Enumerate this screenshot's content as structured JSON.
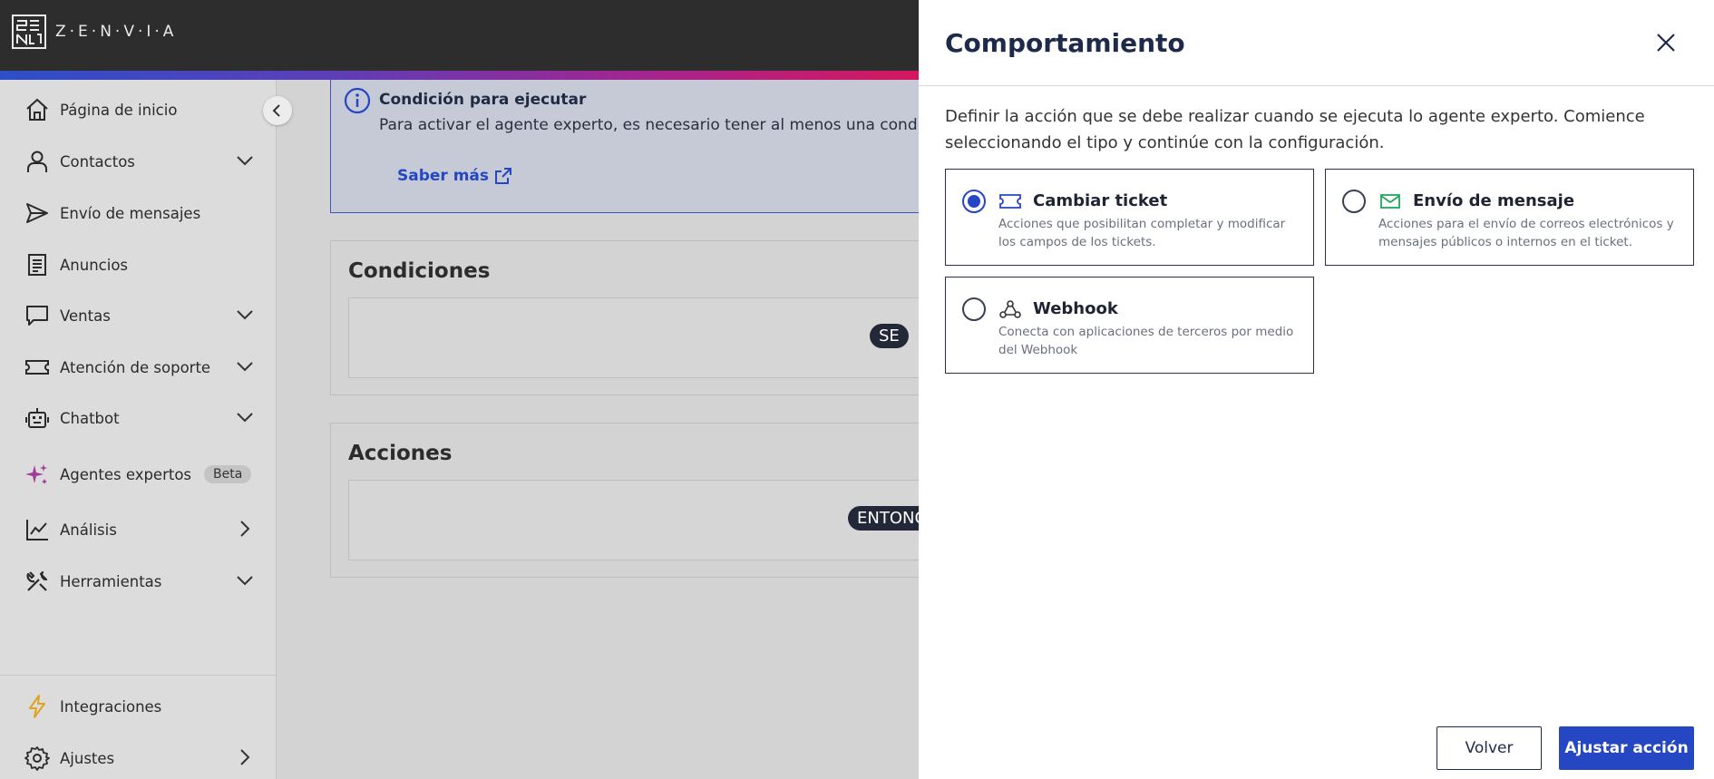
{
  "brand": {
    "name": "Z·E·N·V·I·A"
  },
  "sidebar": {
    "items": [
      {
        "label": "Página de inicio",
        "icon": "home-icon",
        "chevron": "none"
      },
      {
        "label": "Contactos",
        "icon": "user-icon",
        "chevron": "down"
      },
      {
        "label": "Envío de mensajes",
        "icon": "send-icon",
        "chevron": "none"
      },
      {
        "label": "Anuncios",
        "icon": "document-icon",
        "chevron": "none"
      },
      {
        "label": "Ventas",
        "icon": "chat-bubble-icon",
        "chevron": "down"
      },
      {
        "label": "Atención de soporte",
        "icon": "ticket-icon",
        "chevron": "down"
      },
      {
        "label": "Chatbot",
        "icon": "robot-icon",
        "chevron": "down"
      },
      {
        "label": "Agentes expertos",
        "icon": "sparkles-icon",
        "chevron": "none",
        "badge": "Beta"
      },
      {
        "label": "Análisis",
        "icon": "chart-line-icon",
        "chevron": "right"
      },
      {
        "label": "Herramientas",
        "icon": "tools-icon",
        "chevron": "down"
      }
    ],
    "bottom_items": [
      {
        "label": "Integraciones",
        "icon": "lightning-icon"
      },
      {
        "label": "Ajustes",
        "icon": "gear-icon",
        "chevron": "right"
      }
    ]
  },
  "main": {
    "info": {
      "title": "Condición para ejecutar",
      "text": "Para activar el agente experto, es necesario tener al menos una condición",
      "link": "Saber más"
    },
    "conditions": {
      "title": "Condiciones",
      "pill": "SE"
    },
    "actions": {
      "title": "Acciones",
      "pill": "ENTONCES"
    }
  },
  "drawer": {
    "title": "Comportamiento",
    "description": "Definir la acción que se debe realizar cuando se ejecuta lo agente experto. Comience seleccionando el tipo y continúe con la configuración.",
    "options": [
      {
        "title": "Cambiar ticket",
        "description": "Acciones que posibilitan completar y modificar los campos de los tickets.",
        "icon": "ticket-icon",
        "selected": true
      },
      {
        "title": "Envío de mensaje",
        "description": "Acciones para el envío de correos electrónicos y mensajes públicos o internos en el ticket.",
        "icon": "envelope-icon",
        "selected": false
      },
      {
        "title": "Webhook",
        "description": "Conecta con aplicaciones de terceros por medio del Webhook",
        "icon": "webhook-icon",
        "selected": false
      }
    ],
    "back_label": "Volver",
    "submit_label": "Ajustar acción"
  },
  "colors": {
    "primary": "#2547c4",
    "header": "#2d2d2d",
    "beta_badge": "#c4c4c4",
    "envelope": "#1fa85a",
    "sparkle": "#a23c9a"
  }
}
